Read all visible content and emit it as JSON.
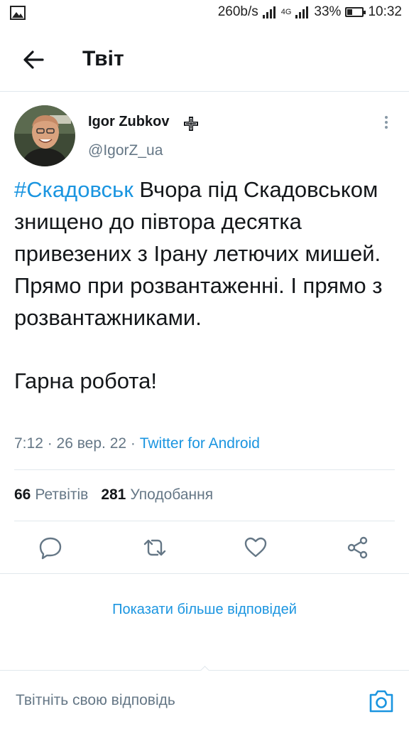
{
  "status_bar": {
    "image_icon": "image-icon",
    "net_speed": "260b/s",
    "network_type": "4G",
    "battery_percent": "33%",
    "battery_level": 0.33,
    "time": "10:32"
  },
  "header": {
    "back_icon": "arrow-left-icon",
    "title": "Твіт"
  },
  "tweet": {
    "author_name": "Igor Zubkov",
    "author_badge_icon": "cross-icon",
    "handle": "@IgorZ_ua",
    "hashtag": "#Скадовськ",
    "text_rest": " Вчора під Скадовськом знищено до півтора десятка привезених з Ірану летючих мишей. Прямо при розвантаженні. І прямо з розвантажниками.",
    "text_second": "Гарна робота!",
    "time": "7:12",
    "date": "26 вер. 22",
    "source": "Twitter for Android",
    "retweets_count": "66",
    "retweets_label": "Ретвітів",
    "likes_count": "281",
    "likes_label": "Уподобання"
  },
  "actions": [
    "reply-icon",
    "retweet-icon",
    "like-icon",
    "share-icon"
  ],
  "show_more_replies": "Показати більше відповідей",
  "reply_placeholder": "Твітніть свою відповідь",
  "colors": {
    "accent": "#1b95e0",
    "secondary_text": "#657786",
    "divider": "#e1e8ed"
  }
}
